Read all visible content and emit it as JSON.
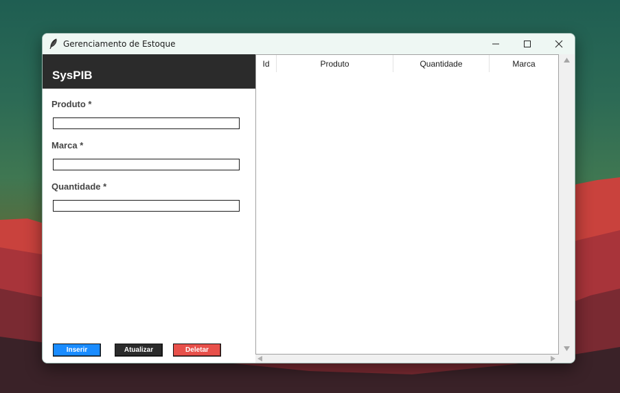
{
  "window": {
    "title": "Gerenciamento de Estoque",
    "icon": "feather-icon"
  },
  "sidebar": {
    "brand": "SysPIB",
    "fields": [
      {
        "label": "Produto *",
        "value": ""
      },
      {
        "label": "Marca *",
        "value": ""
      },
      {
        "label": "Quantidade *",
        "value": ""
      }
    ],
    "buttons": {
      "insert": "Inserir",
      "update": "Atualizar",
      "delete": "Deletar"
    }
  },
  "table": {
    "columns": [
      "Id",
      "Produto",
      "Quantidade",
      "Marca"
    ],
    "rows": []
  },
  "colors": {
    "insert": "#1a8cff",
    "update": "#2b2b2b",
    "delete": "#e8504a",
    "header_bar": "#2b2b2b"
  }
}
